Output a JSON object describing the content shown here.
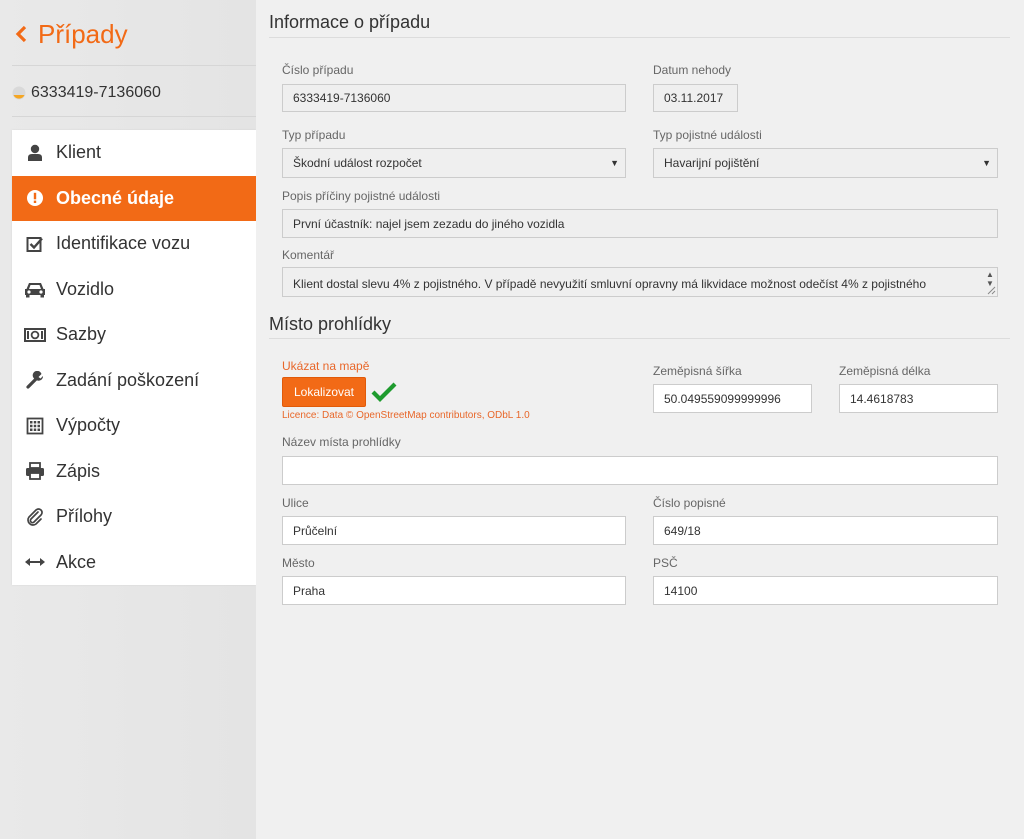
{
  "sidebar": {
    "back_label": "Případy",
    "case_number": "6333419-7136060",
    "items": [
      {
        "label": "Klient",
        "icon": "user-icon"
      },
      {
        "label": "Obecné údaje",
        "icon": "exclamation-circle-icon",
        "active": true
      },
      {
        "label": "Identifikace vozu",
        "icon": "check-square-icon"
      },
      {
        "label": "Vozidlo",
        "icon": "car-icon"
      },
      {
        "label": "Sazby",
        "icon": "money-icon"
      },
      {
        "label": "Zadání poškození",
        "icon": "wrench-icon"
      },
      {
        "label": "Výpočty",
        "icon": "calculator-icon"
      },
      {
        "label": "Zápis",
        "icon": "printer-icon"
      },
      {
        "label": "Přílohy",
        "icon": "paperclip-icon"
      },
      {
        "label": "Akce",
        "icon": "arrows-horizontal-icon"
      }
    ]
  },
  "colors": {
    "accent": "#f26a16",
    "link": "#e8672a",
    "success": "#1e9b2e"
  },
  "info": {
    "title": "Informace o případu",
    "case_number_label": "Číslo případu",
    "case_number_value": "6333419-7136060",
    "accident_date_label": "Datum nehody",
    "accident_date_value": "03.11.2017",
    "case_type_label": "Typ případu",
    "case_type_value": "Škodní událost rozpočet",
    "event_type_label": "Typ pojistné události",
    "event_type_value": "Havarijní pojištění",
    "cause_label": "Popis příčiny pojistné události",
    "cause_value": "První účastník: najel jsem zezadu do jiného vozidla",
    "comment_label": "Komentář",
    "comment_value": "Klient dostal slevu 4% z pojistného. V případě nevyužití smluvní opravny má likvidace možnost odečíst 4% z pojistného"
  },
  "inspection": {
    "title": "Místo prohlídky",
    "map_link": "Ukázat na mapě",
    "locate_button": "Lokalizovat",
    "licence": "Licence: Data © OpenStreetMap contributors, ODbL 1.0",
    "lat_label": "Zeměpisná šířka",
    "lat_value": "50.049559099999996",
    "lon_label": "Zeměpisná délka",
    "lon_value": "14.4618783",
    "place_name_label": "Název místa prohlídky",
    "place_name_value": "",
    "street_label": "Ulice",
    "street_value": "Průčelní",
    "house_number_label": "Číslo popisné",
    "house_number_value": "649/18",
    "city_label": "Město",
    "city_value": "Praha",
    "zip_label": "PSČ",
    "zip_value": "14100"
  }
}
